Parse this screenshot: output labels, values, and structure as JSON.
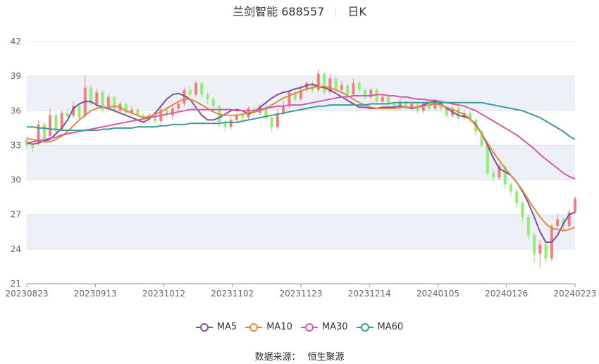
{
  "header": {
    "stock": "兰剑智能 688557",
    "period": "日K"
  },
  "source": {
    "label": "数据来源：",
    "value": "恒生聚源"
  },
  "chart_data": {
    "type": "candlestick",
    "ylim": [
      21,
      42
    ],
    "yticks": [
      21,
      24,
      27,
      30,
      33,
      36,
      39,
      42
    ],
    "x_tick_labels": [
      "20230823",
      "20230913",
      "20231012",
      "20231102",
      "20231123",
      "20231214",
      "20240105",
      "20240126",
      "20240223"
    ],
    "colors": {
      "up": "#f08080",
      "down": "#90ee70",
      "ma5": "#7b4ea8",
      "ma10": "#e08a3a",
      "ma30": "#d55aa8",
      "ma60": "#3d9a9a",
      "band": "#eef0f8"
    },
    "series": [
      {
        "name": "MA5",
        "color": "#7b4ea8",
        "values": [
          33.2,
          33.1,
          33.2,
          33.4,
          33.5,
          34.0,
          34.5,
          35.2,
          36.2,
          36.6,
          36.8,
          36.8,
          36.5,
          36.3,
          36.2,
          36.0,
          35.8,
          35.6,
          35.4,
          35.2,
          35.0,
          35.3,
          35.8,
          36.4,
          37.0,
          37.4,
          37.5,
          37.3,
          37.0,
          36.3,
          35.6,
          35.2,
          35.2,
          35.4,
          35.7,
          36.0,
          36.1,
          36.0,
          35.7,
          35.9,
          36.3,
          36.7,
          37.1,
          37.4,
          37.6,
          37.7,
          37.9,
          38.0,
          38.2,
          38.3,
          38.1,
          38.0,
          37.8,
          37.5,
          37.2,
          36.9,
          36.6,
          36.3,
          36.3,
          36.2,
          36.2,
          36.3,
          36.3,
          36.3,
          36.4,
          36.3,
          36.2,
          36.3,
          36.5,
          36.7,
          36.8,
          36.6,
          36.2,
          35.9,
          35.6,
          35.5,
          35.3,
          34.8,
          34.0,
          33.0,
          31.9,
          31.0,
          30.7,
          30.4,
          29.8,
          29.0,
          28.0,
          26.8,
          25.5,
          24.6,
          24.6,
          25.2,
          26.2,
          27.0,
          27.2
        ]
      },
      {
        "name": "MA10",
        "color": "#e08a3a",
        "values": [
          33.6,
          33.5,
          33.4,
          33.3,
          33.3,
          33.5,
          33.8,
          34.2,
          34.7,
          35.2,
          35.6,
          36.0,
          36.2,
          36.3,
          36.3,
          36.4,
          36.3,
          36.0,
          35.8,
          35.6,
          35.4,
          35.5,
          35.7,
          35.9,
          36.2,
          36.5,
          36.8,
          37.0,
          37.0,
          36.8,
          36.5,
          36.2,
          35.9,
          35.7,
          35.6,
          35.6,
          35.6,
          35.7,
          35.8,
          35.9,
          36.0,
          36.2,
          36.5,
          36.8,
          37.1,
          37.3,
          37.5,
          37.7,
          37.9,
          38.0,
          38.1,
          38.1,
          38.0,
          37.8,
          37.6,
          37.3,
          37.0,
          36.7,
          36.5,
          36.3,
          36.2,
          36.2,
          36.2,
          36.2,
          36.3,
          36.3,
          36.3,
          36.3,
          36.4,
          36.5,
          36.6,
          36.5,
          36.3,
          36.1,
          35.9,
          35.7,
          35.3,
          34.7,
          34.0,
          33.2,
          32.4,
          31.7,
          31.0,
          30.4,
          29.8,
          29.1,
          28.3,
          27.5,
          26.8,
          26.2,
          25.8,
          25.7,
          25.6,
          25.7,
          25.9
        ]
      },
      {
        "name": "MA30",
        "color": "#d55aa8",
        "values": [
          33.2,
          33.3,
          33.4,
          33.5,
          33.6,
          33.7,
          33.9,
          34.0,
          34.1,
          34.2,
          34.3,
          34.4,
          34.5,
          34.6,
          34.7,
          34.8,
          34.9,
          35.0,
          35.1,
          35.2,
          35.3,
          35.4,
          35.5,
          35.6,
          35.7,
          35.8,
          35.9,
          36.0,
          36.1,
          36.1,
          36.1,
          36.1,
          36.1,
          36.1,
          36.1,
          36.1,
          36.0,
          36.0,
          36.0,
          36.0,
          36.1,
          36.2,
          36.3,
          36.4,
          36.4,
          36.5,
          36.5,
          36.5,
          36.6,
          36.7,
          36.8,
          36.9,
          37.0,
          37.1,
          37.2,
          37.2,
          37.3,
          37.3,
          37.3,
          37.3,
          37.4,
          37.4,
          37.3,
          37.3,
          37.2,
          37.2,
          37.1,
          37.0,
          37.0,
          36.9,
          36.9,
          36.8,
          36.7,
          36.6,
          36.5,
          36.4,
          36.2,
          36.0,
          35.7,
          35.4,
          35.1,
          34.8,
          34.5,
          34.2,
          33.9,
          33.5,
          33.1,
          32.7,
          32.2,
          31.8,
          31.4,
          31.0,
          30.6,
          30.3,
          30.1
        ]
      },
      {
        "name": "MA60",
        "color": "#3d9a9a",
        "values": [
          34.6,
          34.6,
          34.5,
          34.5,
          34.4,
          34.4,
          34.3,
          34.3,
          34.3,
          34.3,
          34.3,
          34.3,
          34.3,
          34.4,
          34.4,
          34.5,
          34.5,
          34.5,
          34.5,
          34.6,
          34.6,
          34.6,
          34.6,
          34.7,
          34.7,
          34.8,
          34.8,
          34.8,
          34.9,
          34.9,
          34.9,
          34.9,
          34.9,
          34.9,
          35.0,
          35.0,
          35.0,
          35.1,
          35.2,
          35.3,
          35.4,
          35.5,
          35.6,
          35.7,
          35.8,
          35.9,
          36.0,
          36.1,
          36.2,
          36.3,
          36.4,
          36.4,
          36.5,
          36.5,
          36.5,
          36.5,
          36.5,
          36.5,
          36.5,
          36.6,
          36.6,
          36.6,
          36.6,
          36.7,
          36.7,
          36.7,
          36.7,
          36.7,
          36.7,
          36.7,
          36.7,
          36.7,
          36.7,
          36.7,
          36.7,
          36.7,
          36.7,
          36.7,
          36.7,
          36.6,
          36.5,
          36.4,
          36.3,
          36.2,
          36.1,
          36.0,
          35.8,
          35.6,
          35.4,
          35.1,
          34.8,
          34.5,
          34.2,
          33.8,
          33.5
        ]
      }
    ],
    "candles": [
      [
        33.5,
        33.0,
        33.8,
        32.6
      ],
      [
        33.0,
        32.8,
        33.3,
        32.4
      ],
      [
        33.2,
        34.8,
        35.2,
        33.0
      ],
      [
        34.8,
        33.6,
        35.0,
        33.4
      ],
      [
        33.8,
        35.6,
        36.2,
        33.5
      ],
      [
        35.6,
        34.2,
        35.9,
        34.0
      ],
      [
        34.4,
        35.8,
        36.0,
        34.2
      ],
      [
        35.8,
        35.5,
        36.2,
        35.2
      ],
      [
        35.6,
        36.4,
        36.8,
        35.4
      ],
      [
        36.4,
        35.4,
        36.6,
        35.2
      ],
      [
        35.6,
        38.0,
        39.0,
        35.4
      ],
      [
        38.0,
        36.6,
        38.2,
        36.4
      ],
      [
        36.6,
        37.6,
        37.9,
        36.2
      ],
      [
        37.6,
        36.2,
        37.8,
        35.9
      ],
      [
        36.2,
        37.2,
        37.4,
        36.0
      ],
      [
        37.2,
        36.0,
        37.3,
        35.8
      ],
      [
        36.0,
        36.6,
        36.8,
        35.8
      ],
      [
        36.6,
        35.8,
        36.8,
        35.6
      ],
      [
        35.8,
        36.1,
        36.4,
        35.6
      ],
      [
        36.1,
        35.6,
        36.3,
        35.4
      ],
      [
        35.6,
        35.2,
        35.8,
        35.0
      ],
      [
        35.3,
        35.6,
        35.8,
        35.0
      ],
      [
        35.6,
        35.1,
        35.8,
        34.8
      ],
      [
        35.1,
        36.1,
        36.4,
        34.9
      ],
      [
        36.1,
        35.6,
        36.3,
        35.4
      ],
      [
        35.6,
        36.2,
        36.4,
        35.2
      ],
      [
        36.2,
        36.6,
        36.8,
        36.0
      ],
      [
        36.6,
        37.8,
        38.0,
        36.4
      ],
      [
        37.8,
        37.4,
        38.2,
        37.2
      ],
      [
        37.4,
        38.4,
        38.6,
        37.2
      ],
      [
        38.4,
        37.4,
        38.5,
        37.0
      ],
      [
        37.4,
        37.0,
        37.6,
        36.6
      ],
      [
        37.0,
        36.4,
        37.2,
        36.2
      ],
      [
        36.4,
        35.0,
        36.5,
        34.6
      ],
      [
        35.0,
        34.6,
        35.2,
        34.2
      ],
      [
        34.6,
        35.2,
        35.5,
        34.4
      ],
      [
        35.2,
        35.6,
        35.8,
        35.0
      ],
      [
        35.6,
        35.4,
        35.8,
        35.2
      ],
      [
        35.4,
        36.2,
        36.4,
        35.2
      ],
      [
        36.2,
        35.8,
        36.4,
        35.6
      ],
      [
        35.8,
        36.4,
        36.6,
        35.6
      ],
      [
        36.4,
        35.4,
        36.6,
        35.2
      ],
      [
        35.4,
        34.6,
        35.6,
        34.2
      ],
      [
        34.6,
        35.8,
        36.2,
        34.4
      ],
      [
        35.8,
        36.4,
        36.8,
        35.6
      ],
      [
        36.4,
        37.6,
        37.8,
        36.2
      ],
      [
        37.6,
        37.0,
        38.0,
        36.8
      ],
      [
        37.0,
        37.8,
        38.2,
        36.8
      ],
      [
        37.8,
        38.4,
        38.6,
        37.6
      ],
      [
        38.4,
        37.8,
        38.6,
        37.6
      ],
      [
        37.8,
        39.2,
        39.6,
        37.6
      ],
      [
        39.2,
        37.6,
        39.4,
        37.4
      ],
      [
        37.6,
        38.8,
        39.2,
        37.4
      ],
      [
        38.8,
        37.8,
        39.0,
        37.6
      ],
      [
        37.8,
        38.2,
        38.6,
        37.6
      ],
      [
        38.2,
        37.4,
        38.4,
        37.2
      ],
      [
        37.4,
        38.4,
        38.8,
        37.2
      ],
      [
        38.4,
        37.8,
        38.6,
        37.6
      ],
      [
        37.8,
        37.2,
        38.0,
        37.0
      ],
      [
        37.2,
        37.8,
        38.0,
        37.0
      ],
      [
        37.8,
        36.8,
        38.0,
        36.6
      ],
      [
        36.8,
        37.2,
        37.4,
        36.6
      ],
      [
        37.2,
        36.6,
        37.4,
        36.4
      ],
      [
        36.6,
        36.2,
        36.8,
        36.0
      ],
      [
        36.2,
        36.8,
        37.0,
        36.0
      ],
      [
        36.8,
        36.2,
        37.0,
        36.0
      ],
      [
        36.2,
        36.6,
        36.8,
        36.0
      ],
      [
        36.6,
        36.0,
        36.8,
        35.8
      ],
      [
        36.0,
        36.6,
        36.8,
        35.8
      ],
      [
        36.6,
        36.2,
        36.8,
        36.0
      ],
      [
        36.2,
        36.8,
        37.0,
        36.0
      ],
      [
        36.8,
        36.2,
        37.0,
        35.9
      ],
      [
        36.2,
        35.6,
        36.4,
        35.4
      ],
      [
        35.6,
        36.2,
        36.4,
        35.4
      ],
      [
        36.2,
        35.4,
        36.4,
        35.2
      ],
      [
        35.4,
        35.8,
        36.0,
        35.2
      ],
      [
        35.8,
        35.2,
        36.0,
        35.0
      ],
      [
        35.2,
        34.2,
        35.4,
        33.8
      ],
      [
        34.2,
        33.0,
        34.4,
        32.8
      ],
      [
        33.0,
        30.6,
        33.2,
        30.2
      ],
      [
        30.6,
        30.2,
        31.0,
        29.8
      ],
      [
        30.2,
        31.2,
        31.4,
        30.0
      ],
      [
        31.2,
        29.6,
        31.4,
        29.2
      ],
      [
        29.6,
        29.0,
        29.8,
        28.6
      ],
      [
        29.0,
        28.0,
        29.2,
        27.6
      ],
      [
        28.0,
        26.8,
        28.2,
        26.4
      ],
      [
        26.8,
        25.2,
        27.0,
        24.8
      ],
      [
        25.2,
        23.6,
        25.4,
        22.8
      ],
      [
        23.6,
        24.4,
        24.8,
        22.4
      ],
      [
        24.4,
        23.2,
        24.6,
        22.8
      ],
      [
        23.2,
        26.0,
        26.2,
        23.0
      ],
      [
        26.0,
        26.6,
        27.0,
        25.8
      ],
      [
        26.6,
        26.0,
        26.8,
        25.6
      ],
      [
        26.0,
        27.2,
        27.4,
        25.8
      ],
      [
        27.2,
        28.4,
        28.6,
        27.0
      ]
    ]
  }
}
